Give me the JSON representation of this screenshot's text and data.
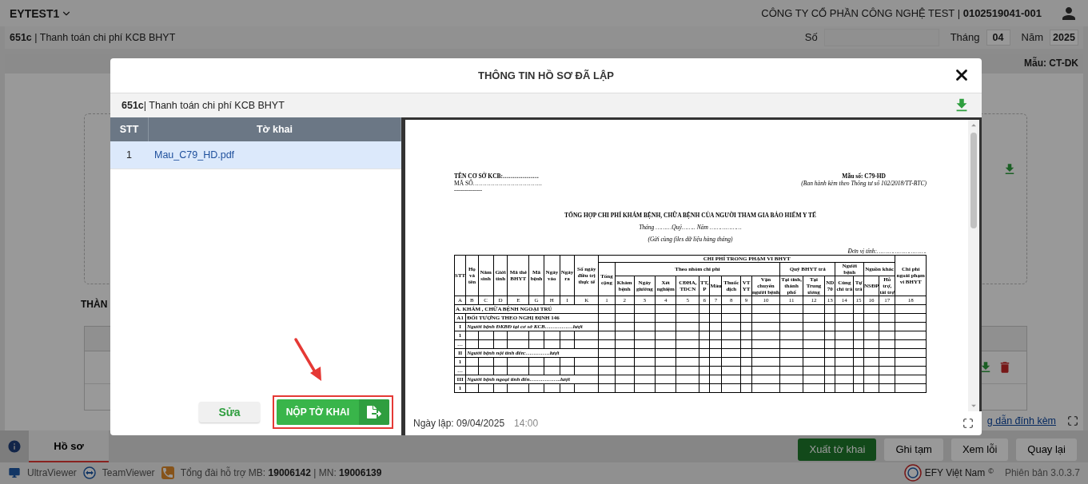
{
  "app": {
    "account": "EYTEST1",
    "company": "CÔNG TY CỔ PHẦN CÔNG NGHỆ TEST | **0102519041-001**"
  },
  "form_bar": {
    "title": "**651c** | Thanh toán chi phí KCB BHYT",
    "number_label": "Số",
    "month_label": "Tháng",
    "month": "04",
    "year_label": "Năm",
    "year": "2025"
  },
  "template": "Mẫu: CT-DK",
  "background": {
    "section_title": "THÀN",
    "guide_link": "g dẫn đính kèm",
    "buttons": [
      {
        "label": "Xuất tờ khai",
        "kind": "primary"
      },
      {
        "label": "Ghi tạm",
        "kind": "default"
      },
      {
        "label": "Xem lỗi",
        "kind": "default"
      },
      {
        "label": "Quay lại",
        "kind": "default"
      }
    ]
  },
  "tabs": [
    {
      "label": "Hồ sơ",
      "selected": true
    }
  ],
  "footer": {
    "tools": [
      "UltraViewer",
      "TeamViewer"
    ],
    "hotline": "Tổng đài hỗ trợ MB: **19006142** | MN: **19006139**",
    "brand": "EFY Việt Nam",
    "copyright": "©",
    "version": "Phiên bản 3.0.3.7"
  },
  "modal": {
    "title": "THÔNG TIN HỒ SƠ ĐÃ LẬP",
    "form_title": "**651c**| Thanh toán chi phí KCB BHYT",
    "file_columns": [
      "STT",
      "Tờ khai"
    ],
    "files": [
      {
        "stt": "1",
        "name": "Mau_C79_HD.pdf",
        "selected": true
      }
    ],
    "edit_button": "Sửa",
    "submit_button": "NỘP TỜ KHAI",
    "created": "Ngày lập: 09/04/2025",
    "created_time": "14:00"
  },
  "document": {
    "facility": "TÊN CƠ SỞ KCB:………………",
    "code_line": "MÃ SỐ……………………………..",
    "rule": "--------------",
    "form_no": "Mẫu số: C79-HD",
    "issued": "(Ban hành kèm theo Thông tư số 102/2018/TT-BTC)",
    "title": "TỔNG HỢP CHI PHÍ KHÁM BỆNH, CHỮA BỆNH CỦA NGƯỜI THAM GIA BẢO HIỂM Y TẾ",
    "period": "Tháng ………Quý…….. Năm ………………",
    "note": "(Gửi cùng files dữ liệu hàng tháng)",
    "unit": "Đơn vị tính:……………………….",
    "columns": [
      {
        "label": "STT"
      },
      {
        "label": "Họ và tên"
      },
      {
        "label": "Năm sinh"
      },
      {
        "label": "Giới tính"
      },
      {
        "label": "Mã thẻ BHYT"
      },
      {
        "label": "Mã bệnh"
      },
      {
        "label": "Ngày vào"
      },
      {
        "label": "Ngày ra"
      },
      {
        "label": "Số ngày điều trị thực tế"
      },
      {
        "label": "CHI PHÍ TRONG PHẠM VI BHYT",
        "children": [
          {
            "label": "Tổng cộng"
          },
          {
            "label": "Theo nhóm chi phí",
            "children": [
              {
                "label": "Khám bệnh"
              },
              {
                "label": "Ngày giường"
              },
              {
                "label": "Xét nghiệm"
              },
              {
                "label": "CĐHA, TDCN"
              },
              {
                "label": "TT, P"
              },
              {
                "label": "Máu"
              },
              {
                "label": "Thuốc dịch"
              },
              {
                "label": "VT YT"
              },
              {
                "label": "Vận chuyển người bệnh"
              }
            ]
          },
          {
            "label": "Quỹ BHYT trả",
            "children": [
              {
                "label": "Tại tỉnh, thành phố"
              },
              {
                "label": "Tại Trung ương"
              },
              {
                "label": "ND 70"
              }
            ]
          },
          {
            "label": "Người bệnh",
            "children": [
              {
                "label": "Cùng chi trả"
              },
              {
                "label": "Tự trả"
              }
            ]
          },
          {
            "label": "Nguồn khác",
            "children": [
              {
                "label": "NSĐP"
              },
              {
                "label": "Hỗ trợ, tài trợ"
              }
            ]
          }
        ]
      },
      {
        "label": "Chi phí ngoài phạm vi BHYT"
      }
    ],
    "column_codes": [
      "A",
      "B",
      "C",
      "D",
      "E",
      "G",
      "H",
      "I",
      "K",
      "1",
      "2",
      "3",
      "4",
      "5",
      "6",
      "7",
      "8",
      "9",
      "10",
      "11",
      "12",
      "13",
      "14",
      "15",
      "16",
      "17",
      "18"
    ],
    "rows": [
      {
        "kind": "section",
        "text": "A. KHÁM , CHỮA BỆNH NGOẠI TRÚ"
      },
      {
        "kind": "group",
        "stt": "A1",
        "text": "ĐỐI TƯỢNG THEO NGHỊ ĐỊNH 146"
      },
      {
        "kind": "subgroup",
        "stt": "I",
        "text": "Người bệnh ĐKBĐ tại cơ sở KCB……………lượt"
      },
      {
        "kind": "item",
        "stt": "1"
      },
      {
        "kind": "item",
        "stt": "…"
      },
      {
        "kind": "subgroup",
        "stt": "II",
        "text": "Người bệnh nội tỉnh đến:………….lượt"
      },
      {
        "kind": "item",
        "stt": "1"
      },
      {
        "kind": "item",
        "stt": "…"
      },
      {
        "kind": "subgroup",
        "stt": "III",
        "text": "Người bệnh ngoại tỉnh đến……………..lượt"
      },
      {
        "kind": "item",
        "stt": "1"
      }
    ]
  }
}
